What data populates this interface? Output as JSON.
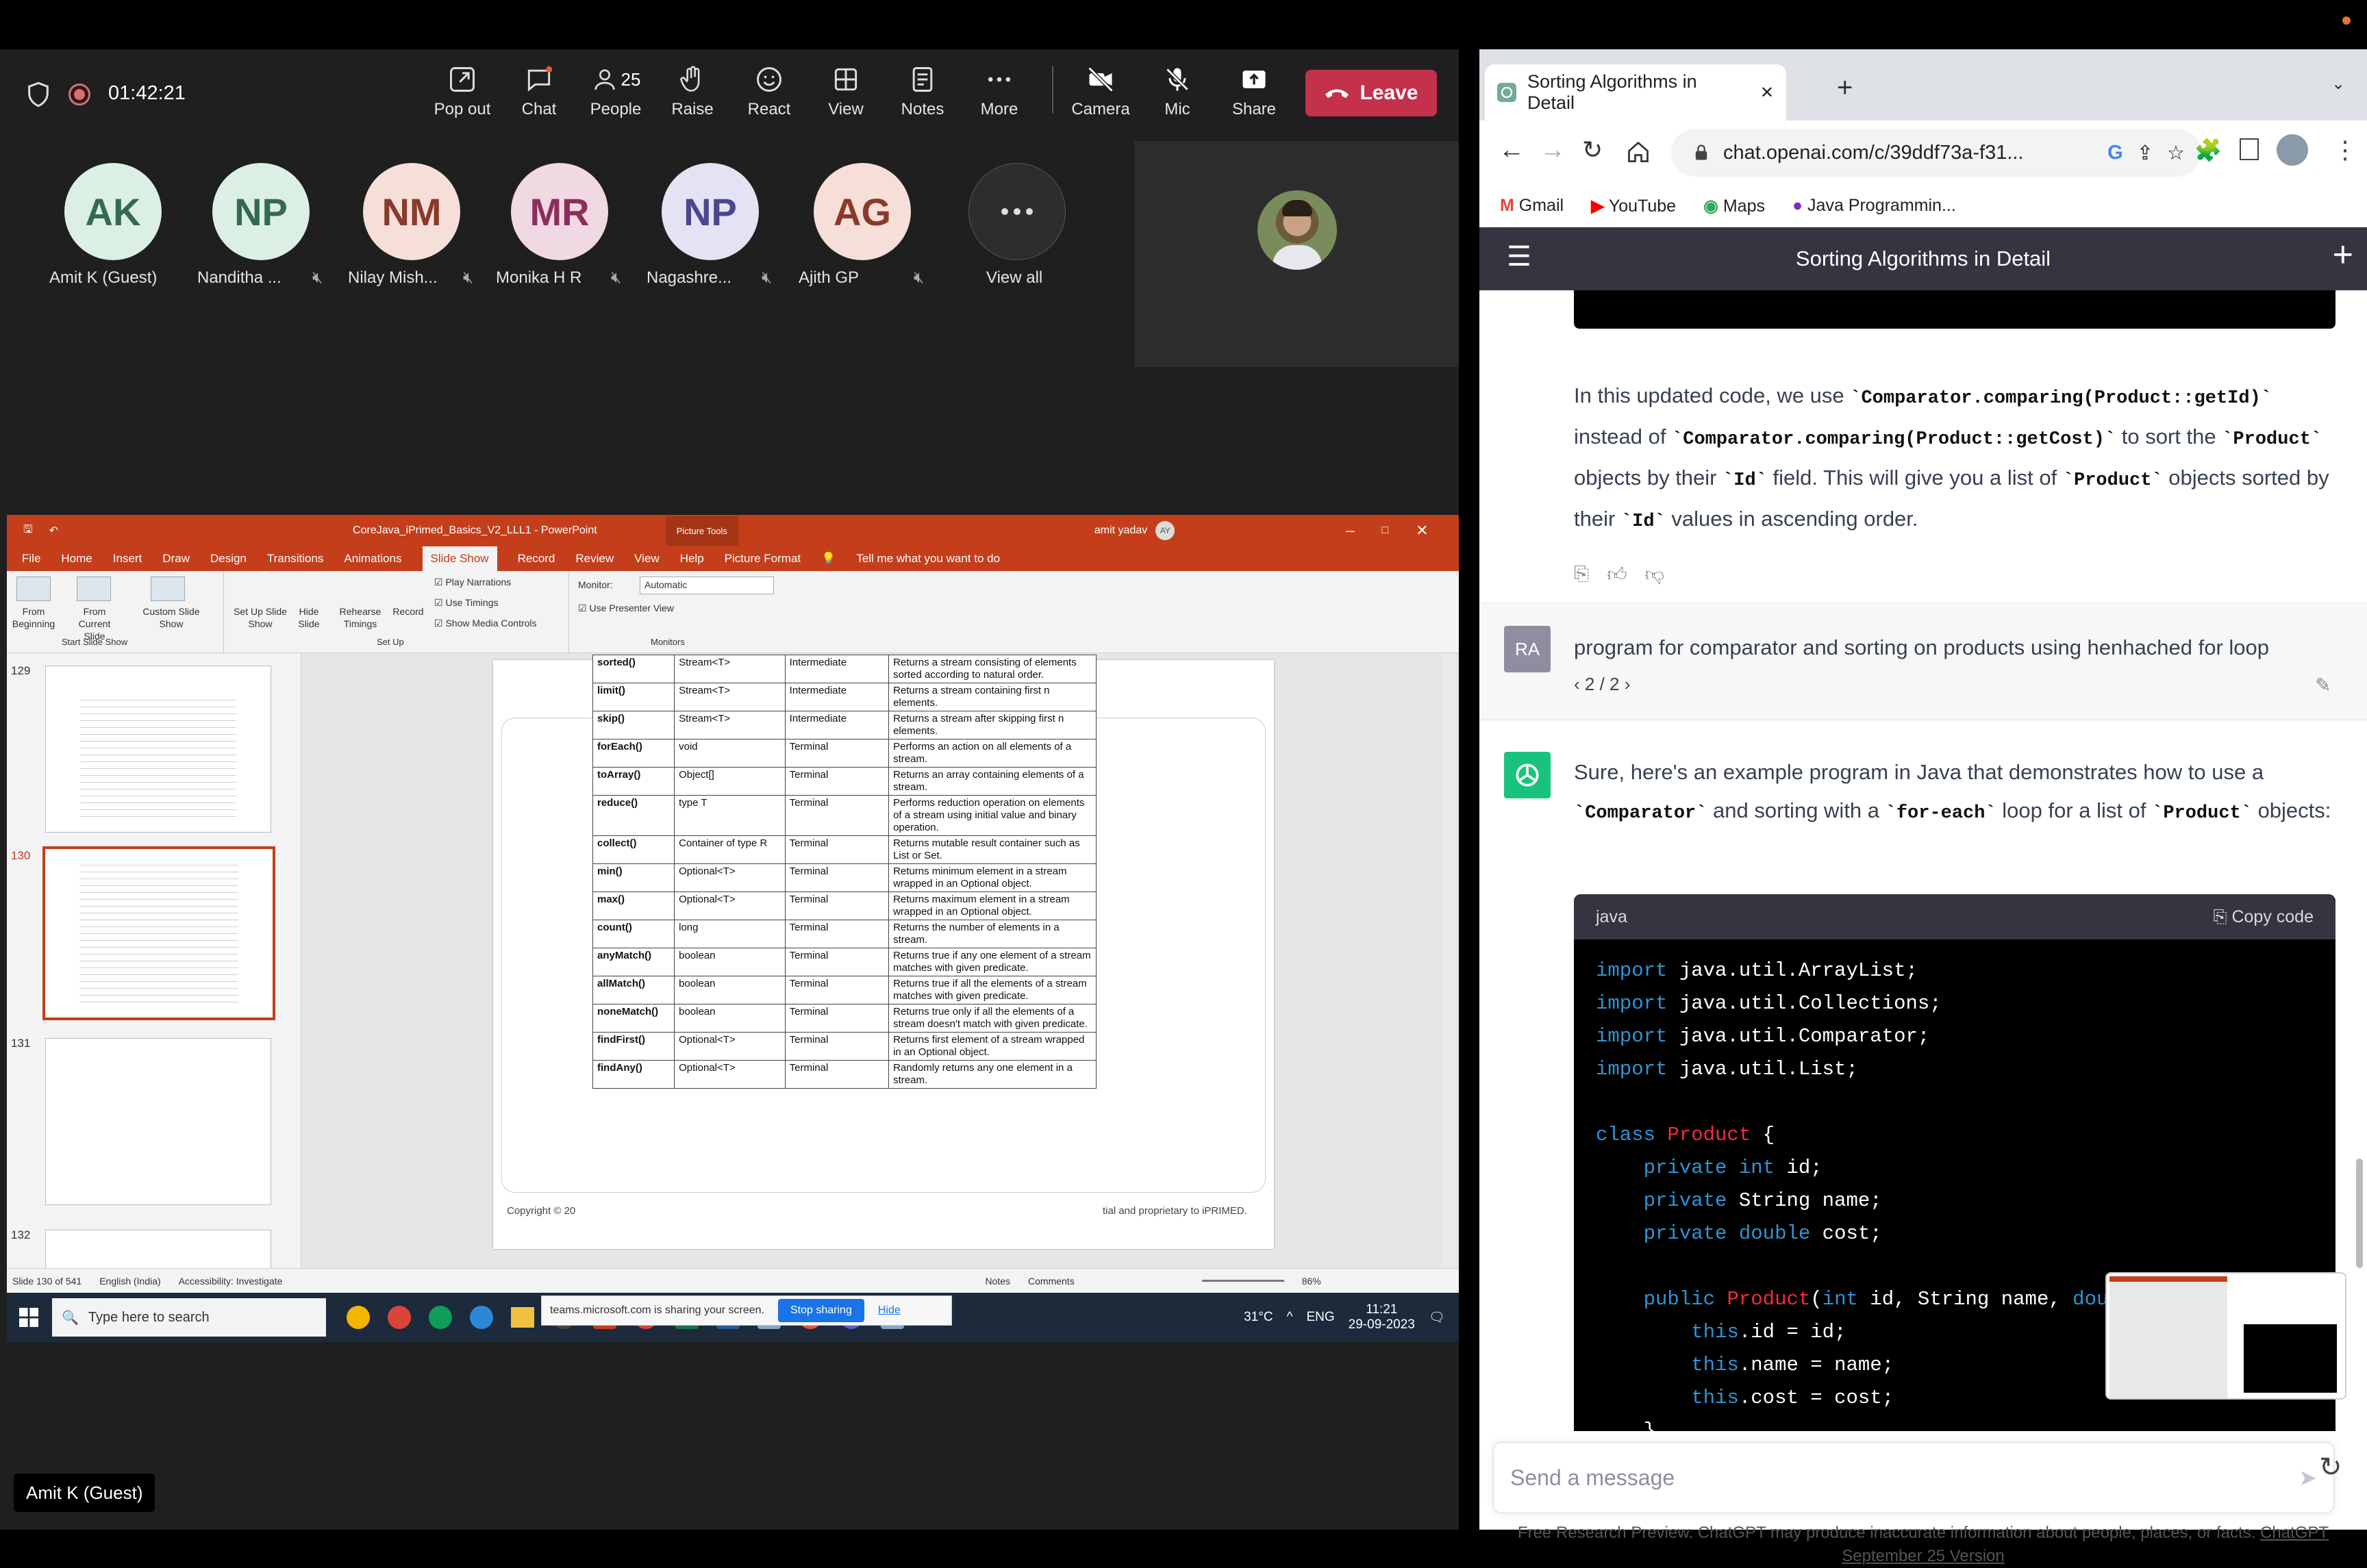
{
  "teams": {
    "timer": "01:42:21",
    "toolbar": {
      "popout": "Pop out",
      "chat": "Chat",
      "people_count": "25",
      "people": "People",
      "raise": "Raise",
      "react": "React",
      "view": "View",
      "notes": "Notes",
      "more": "More",
      "camera": "Camera",
      "mic": "Mic",
      "share": "Share",
      "leave": "Leave"
    },
    "participants": [
      {
        "initials": "AK",
        "name": "Amit K (Guest)",
        "bg": "#dcefe4",
        "fg": "#346b4f"
      },
      {
        "initials": "NP",
        "name": "Nanditha ...",
        "bg": "#dcefe4",
        "fg": "#346b4f"
      },
      {
        "initials": "NM",
        "name": "Nilay Mish...",
        "bg": "#f6dfd8",
        "fg": "#8a3a2a"
      },
      {
        "initials": "MR",
        "name": "Monika H R",
        "bg": "#f1d9e4",
        "fg": "#8b2e5c"
      },
      {
        "initials": "NP",
        "name": "Nagashre...",
        "bg": "#e4e3f3",
        "fg": "#4a4790"
      },
      {
        "initials": "AG",
        "name": "Ajith GP",
        "bg": "#f6dfd8",
        "fg": "#8a3a2a"
      }
    ],
    "view_all": "View all",
    "presenter_name": "Amit K (Guest)"
  },
  "ppt": {
    "title": "CoreJava_iPrimed_Basics_V2_LLL1 - PowerPoint",
    "picture_tools": "Picture Tools",
    "user": "amit yadav",
    "user_initials": "AY",
    "tabs": [
      "File",
      "Home",
      "Insert",
      "Draw",
      "Design",
      "Transitions",
      "Animations",
      "Slide Show",
      "Record",
      "Review",
      "View",
      "Help",
      "Picture Format"
    ],
    "tell_me": "Tell me what you want to do",
    "ribbon": {
      "from_beginning": "From Beginning",
      "from_current": "From Current Slide",
      "custom": "Custom Slide Show",
      "group_start": "Start Slide Show",
      "setup": "Set Up Slide Show",
      "hide": "Hide Slide",
      "rehearse": "Rehearse Timings",
      "record": "Record",
      "play_narr": "Play Narrations",
      "use_timings": "Use Timings",
      "media": "Show Media Controls",
      "group_setup": "Set Up",
      "monitor_label": "Monitor:",
      "monitor_value": "Automatic",
      "presenter": "Use Presenter View",
      "group_monitors": "Monitors"
    },
    "slide_numbers": [
      "129",
      "130",
      "131",
      "132"
    ],
    "table_rows": [
      [
        "sorted()",
        "Stream<T>",
        "Intermediate",
        "Returns a stream consisting of elements sorted according to natural order."
      ],
      [
        "limit()",
        "Stream<T>",
        "Intermediate",
        "Returns a stream containing first n elements."
      ],
      [
        "skip()",
        "Stream<T>",
        "Intermediate",
        "Returns a stream after skipping first n elements."
      ],
      [
        "forEach()",
        "void",
        "Terminal",
        "Performs an action on all elements of a stream."
      ],
      [
        "toArray()",
        "Object[]",
        "Terminal",
        "Returns an array containing elements of a stream."
      ],
      [
        "reduce()",
        "type T",
        "Terminal",
        "Performs reduction operation on elements of a stream using initial value and binary operation."
      ],
      [
        "collect()",
        "Container of type R",
        "Terminal",
        "Returns mutable result container such as List or Set."
      ],
      [
        "min()",
        "Optional<T>",
        "Terminal",
        "Returns minimum element in a stream wrapped in an Optional object."
      ],
      [
        "max()",
        "Optional<T>",
        "Terminal",
        "Returns maximum element in a stream wrapped in an Optional object."
      ],
      [
        "count()",
        "long",
        "Terminal",
        "Returns the number of elements in a stream."
      ],
      [
        "anyMatch()",
        "boolean",
        "Terminal",
        "Returns true if any one element of a stream matches with given predicate."
      ],
      [
        "allMatch()",
        "boolean",
        "Terminal",
        "Returns true if all the elements of a stream matches with given predicate."
      ],
      [
        "noneMatch()",
        "boolean",
        "Terminal",
        "Returns true only if all the elements of a stream doesn't match with given predicate."
      ],
      [
        "findFirst()",
        "Optional<T>",
        "Terminal",
        "Returns first element of a stream wrapped in an Optional object."
      ],
      [
        "findAny()",
        "Optional<T>",
        "Terminal",
        "Randomly returns any one element in a stream."
      ]
    ],
    "copyright_left": "Copyright © 20",
    "copyright_right": "tial and proprietary to iPRIMED.",
    "sharing_text": "teams.microsoft.com is sharing your screen.",
    "stop_sharing": "Stop sharing",
    "hide": "Hide",
    "status": {
      "slide": "Slide 130 of 541",
      "lang": "English (India)",
      "access": "Accessibility: Investigate",
      "notes": "Notes",
      "comments": "Comments",
      "zoom": "86%"
    },
    "taskbar": {
      "search": "Type here to search",
      "temp": "31°C",
      "lang": "ENG",
      "time": "11:21",
      "date": "29-09-2023"
    }
  },
  "chrome": {
    "tab_title": "Sorting Algorithms in Detail",
    "url": "chat.openai.com/c/39ddf73a-f31...",
    "bookmarks": [
      "Gmail",
      "YouTube",
      "Maps",
      "Java Programmin..."
    ],
    "header_title": "Sorting Algorithms in Detail"
  },
  "chat": {
    "answer1_parts": {
      "p1": "In this updated code, we use ",
      "c1": "`Comparator.comparing(Product::getId)`",
      "p2": " instead of ",
      "c2": "`Comparator.comparing(Product::getCost)`",
      "p3": " to sort the ",
      "c3": "`Product`",
      "p4": " objects by their ",
      "c4": "`Id`",
      "p5": " field. This will give you a list of ",
      "c5": "`Product`",
      "p6": " objects sorted by their ",
      "c6": "`Id`",
      "p7": " values in ascending order."
    },
    "user_initials": "RA",
    "user_message": "program  for comparator and sorting on products using henhached for loop",
    "pager": "2 / 2",
    "answer2_parts": {
      "p1": "Sure, here's an example program in Java that demonstrates how to use a ",
      "c1": "`Comparator`",
      "p2": " and sorting with a ",
      "c2": "`for-each`",
      "p3": " loop for a list of ",
      "c3": "`Product`",
      "p4": " objects:"
    },
    "code_lang": "java",
    "copy_code": "Copy code",
    "input_placeholder": "Send a message",
    "disclaimer": "Free Research Preview. ChatGPT may produce inaccurate information about people, places, or facts.",
    "disclaimer_link": "ChatGPT September 25 Version"
  }
}
